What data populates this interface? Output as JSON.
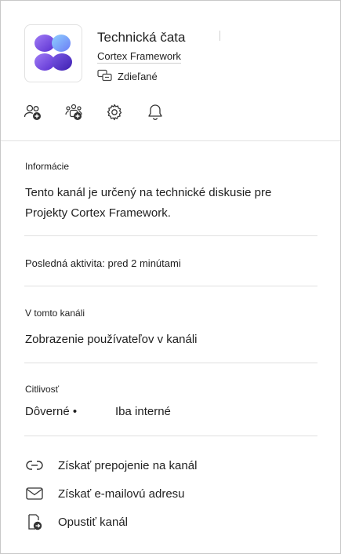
{
  "header": {
    "team_name": "Technická čata",
    "framework_name": "Cortex Framework",
    "shared_label": "Zdieľané",
    "logo_colors": [
      "#7a4fe0",
      "#6aa7ff",
      "#4b2bc2"
    ]
  },
  "toolbar": {
    "icons": [
      "add-member-icon",
      "manage-team-icon",
      "settings-icon",
      "notifications-icon"
    ]
  },
  "info": {
    "heading": "Informácie",
    "description": "Tento kanál je určený na technické diskusie pre Projekty Cortex Framework."
  },
  "activity": {
    "text": "Posledná aktivita: pred 2 minútami"
  },
  "channel": {
    "heading": "V tomto kanáli",
    "link": "Zobrazenie používateľov v kanáli"
  },
  "sensitivity": {
    "heading": "Citlivosť",
    "level": "Dôverné •",
    "scope": "Iba interné"
  },
  "actions": [
    {
      "label": "Získať prepojenie na kanál",
      "icon": "link-icon"
    },
    {
      "label": "Získať e-mailovú adresu",
      "icon": "mail-icon"
    },
    {
      "label": "Opustiť kanál",
      "icon": "leave-icon"
    }
  ]
}
